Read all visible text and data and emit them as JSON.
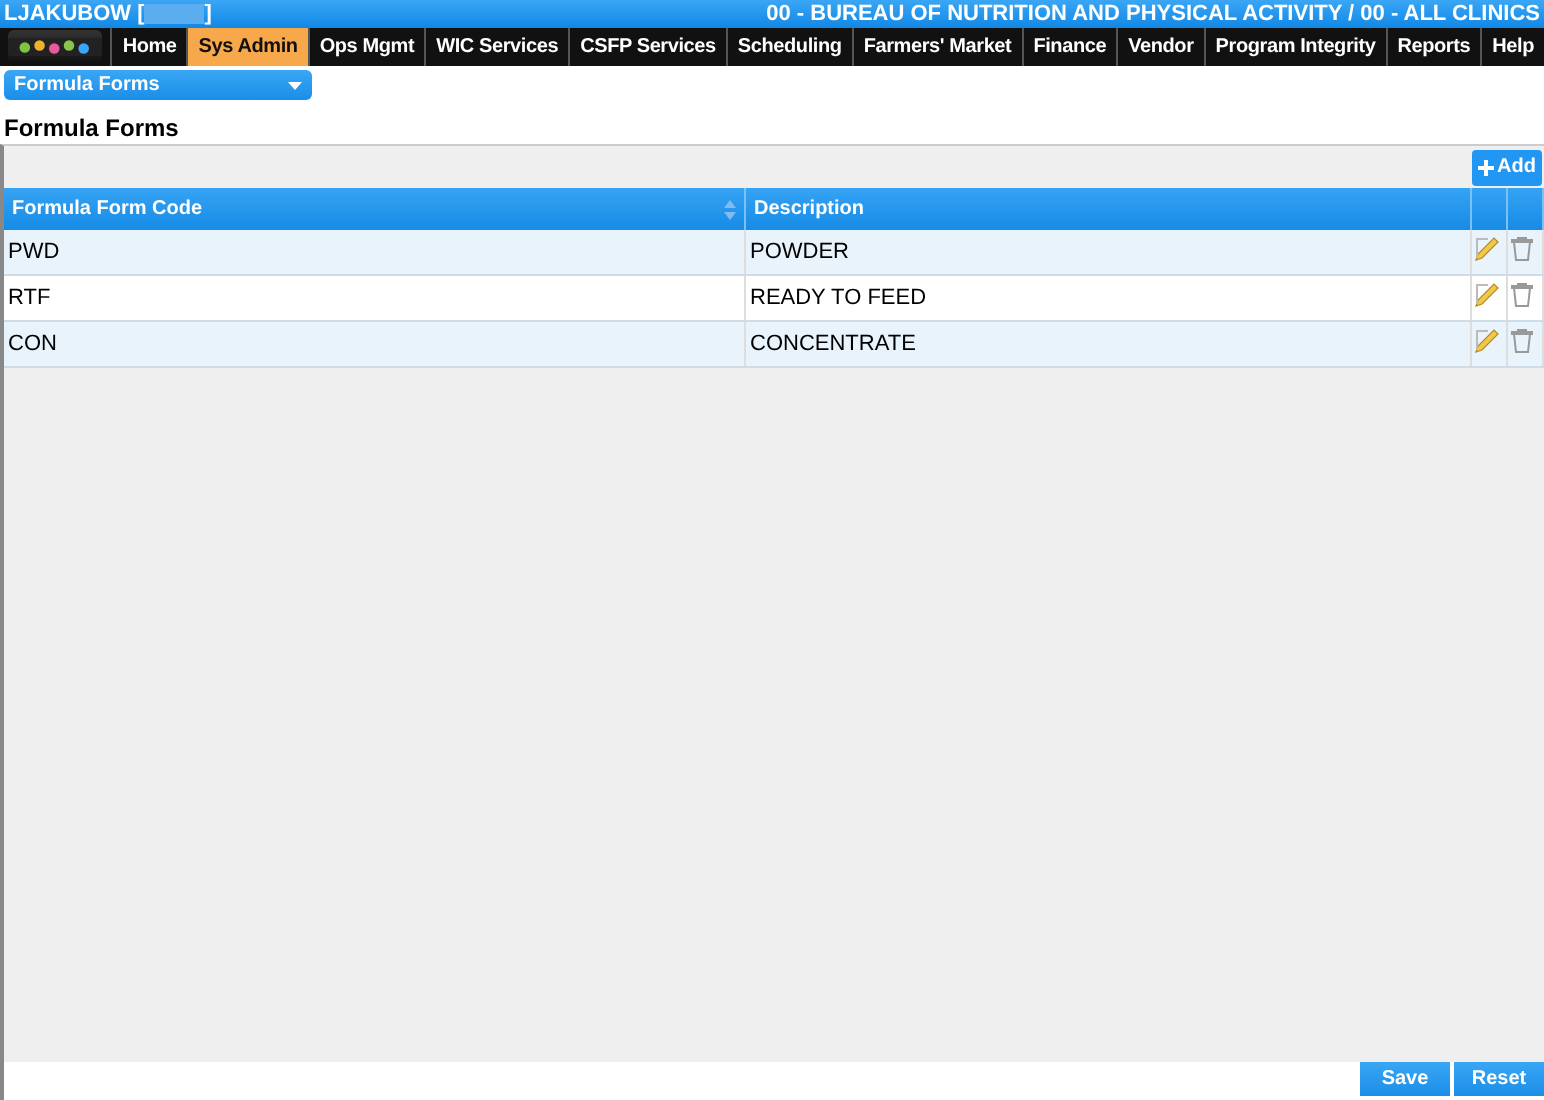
{
  "header": {
    "user": "LJAKUBOW [",
    "user_end": "]",
    "agency": "00 - BUREAU OF NUTRITION AND PHYSICAL ACTIVITY / 00 - ALL CLINICS"
  },
  "menu": [
    {
      "label": "Home",
      "selected": false
    },
    {
      "label": "Sys Admin",
      "selected": true
    },
    {
      "label": "Ops Mgmt",
      "selected": false
    },
    {
      "label": "WIC Services",
      "selected": false
    },
    {
      "label": "CSFP Services",
      "selected": false
    },
    {
      "label": "Scheduling",
      "selected": false
    },
    {
      "label": "Farmers' Market",
      "selected": false
    },
    {
      "label": "Finance",
      "selected": false
    },
    {
      "label": "Vendor",
      "selected": false
    },
    {
      "label": "Program Integrity",
      "selected": false
    },
    {
      "label": "Reports",
      "selected": false
    },
    {
      "label": "Help",
      "selected": false
    }
  ],
  "page_select": {
    "value": "Formula Forms"
  },
  "title": "Formula Forms",
  "add_button": "Add",
  "table": {
    "columns": [
      "Formula Form Code",
      "Description"
    ],
    "rows": [
      {
        "code": "PWD",
        "description": "POWDER"
      },
      {
        "code": "RTF",
        "description": "READY TO FEED"
      },
      {
        "code": "CON",
        "description": "CONCENTRATE"
      }
    ]
  },
  "footer_buttons": [
    "Save",
    "Reset"
  ]
}
